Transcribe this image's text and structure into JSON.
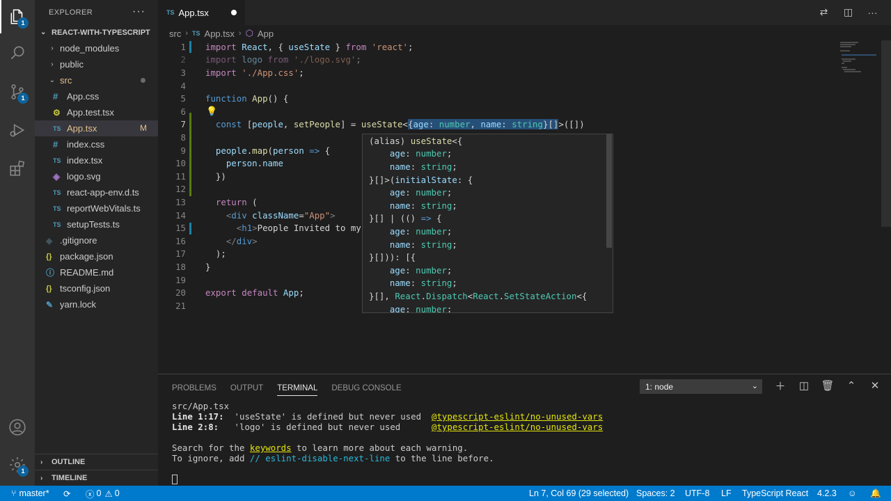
{
  "activity": {
    "explorer_badge": "1",
    "scm_badge": "1",
    "settings_badge": "1"
  },
  "sidebar": {
    "title": "EXPLORER",
    "more": "···",
    "project": "REACT-WITH-TYPESCRIPT",
    "items": [
      {
        "label": "node_modules",
        "icon": "folder-chevron"
      },
      {
        "label": "public",
        "icon": "folder-chevron"
      },
      {
        "label": "src",
        "icon": "folder-open"
      },
      {
        "label": "App.css",
        "icon": "#"
      },
      {
        "label": "App.test.tsx",
        "icon": "gear-icon"
      },
      {
        "label": "App.tsx",
        "icon": "TS",
        "status": "M"
      },
      {
        "label": "index.css",
        "icon": "#"
      },
      {
        "label": "index.tsx",
        "icon": "TS"
      },
      {
        "label": "logo.svg",
        "icon": "svg"
      },
      {
        "label": "react-app-env.d.ts",
        "icon": "TS"
      },
      {
        "label": "reportWebVitals.ts",
        "icon": "TS"
      },
      {
        "label": "setupTests.ts",
        "icon": "TS"
      },
      {
        "label": ".gitignore",
        "icon": "git"
      },
      {
        "label": "package.json",
        "icon": "{}"
      },
      {
        "label": "README.md",
        "icon": "info"
      },
      {
        "label": "tsconfig.json",
        "icon": "{}"
      },
      {
        "label": "yarn.lock",
        "icon": "yarn"
      }
    ],
    "outline": "OUTLINE",
    "timeline": "TIMELINE"
  },
  "editor": {
    "tab_label": "App.tsx",
    "tab_icon": "TS",
    "breadcrumb": [
      "src",
      "App.tsx",
      "App"
    ],
    "lines": [
      "1",
      "2",
      "3",
      "4",
      "5",
      "6",
      "7",
      "8",
      "9",
      "10",
      "11",
      "12",
      "13",
      "14",
      "15",
      "16",
      "17",
      "18",
      "19",
      "20",
      "21"
    ]
  },
  "hover": {
    "lines": [
      "(alias) useState<{",
      "    age: number;",
      "    name: string;",
      "}[]>(initialState: {",
      "    age: number;",
      "    name: string;",
      "}[] | (() => {",
      "    age: number;",
      "    name: string;",
      "}[])): [{",
      "    age: number;",
      "    name: string;",
      "}[], React.Dispatch<React.SetStateAction<{",
      "    age: number;"
    ]
  },
  "panel": {
    "tabs": [
      "PROBLEMS",
      "OUTPUT",
      "TERMINAL",
      "DEBUG CONSOLE"
    ],
    "active_tab": "TERMINAL",
    "terminal_select": "1: node",
    "term": {
      "file": "src/App.tsx",
      "l1_loc": "Line 1:17:",
      "l1_msg": "  'useState' is defined but never used  ",
      "l1_rule": "@typescript-eslint/no-unused-vars",
      "l2_loc": "Line 2:8:",
      "l2_msg": "   'logo' is defined but never used      ",
      "l2_rule": "@typescript-eslint/no-unused-vars",
      "search_a": "Search for the ",
      "search_kw": "keywords",
      "search_b": " to learn more about each warning.",
      "ignore_a": "To ignore, add ",
      "ignore_kw": "// eslint-disable-next-line",
      "ignore_b": " to the line before."
    }
  },
  "status": {
    "branch": "master*",
    "errors": "0",
    "warnings": "0",
    "position": "Ln 7, Col 69 (29 selected)",
    "spaces": "Spaces: 2",
    "encoding": "UTF-8",
    "eol": "LF",
    "language": "TypeScript React",
    "version": "4.2.3"
  }
}
